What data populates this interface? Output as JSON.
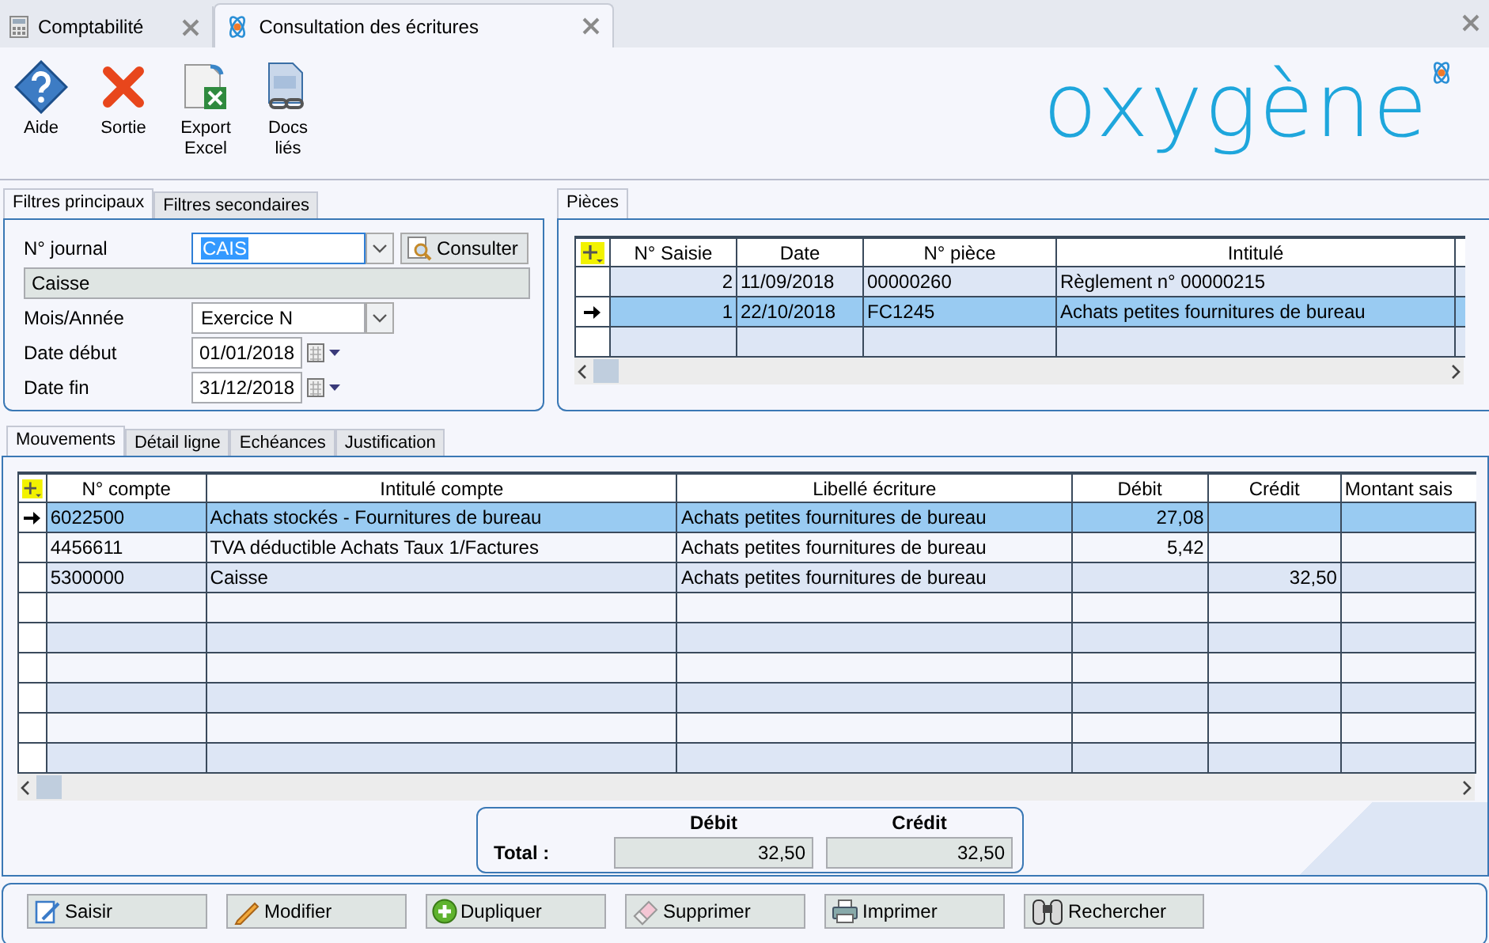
{
  "window_tabs": [
    {
      "label": "Comptabilité",
      "kind": "calculator",
      "selected": false
    },
    {
      "label": "Consultation des écritures",
      "kind": "atom",
      "selected": true
    }
  ],
  "toolbar": [
    {
      "label": "Aide",
      "kind": "help"
    },
    {
      "label": "Sortie",
      "kind": "exit"
    },
    {
      "label": "Export\nExcel",
      "kind": "excel"
    },
    {
      "label": "Docs\nliés",
      "kind": "docs"
    }
  ],
  "logo": "oxygène",
  "filter_tabs": [
    {
      "label": "Filtres principaux",
      "selected": true
    },
    {
      "label": "Filtres secondaires",
      "selected": false
    }
  ],
  "filters": {
    "journal": {
      "label": "N° journal",
      "value": "CAIS",
      "description": "Caisse",
      "button": "Consulter"
    },
    "period": {
      "label": "Mois/Année",
      "value": "Exercice N"
    },
    "date_start": {
      "label": "Date début",
      "value": "01/01/2018"
    },
    "date_end": {
      "label": "Date fin",
      "value": "31/12/2018"
    }
  },
  "pieces": {
    "tab": "Pièces",
    "columns": [
      "N° Saisie",
      "Date",
      "N° pièce",
      "Intitulé"
    ],
    "rows": [
      {
        "entry_no": "2",
        "date": "11/09/2018",
        "piece_no": "00000260",
        "title": "Règlement n° 00000215",
        "selected": false
      },
      {
        "entry_no": "1",
        "date": "22/10/2018",
        "piece_no": "FC1245",
        "title": "Achats petites fournitures de bureau",
        "selected": true
      }
    ]
  },
  "detail_tabs": [
    {
      "label": "Mouvements",
      "selected": true
    },
    {
      "label": "Détail ligne",
      "selected": false
    },
    {
      "label": "Echéances",
      "selected": false
    },
    {
      "label": "Justification",
      "selected": false
    }
  ],
  "entries": {
    "columns": [
      "N° compte",
      "Intitulé compte",
      "Libellé écriture",
      "Débit",
      "Crédit",
      "Montant sais"
    ],
    "rows": [
      {
        "account": "6022500",
        "account_title": "Achats stockés - Fournitures de bureau",
        "entry_label": "Achats petites fournitures de bureau",
        "debit": "27,08",
        "selected": true
      },
      {
        "account": "4456611",
        "account_title": "TVA déductible Achats Taux 1/Factures",
        "entry_label": "Achats petites fournitures de bureau",
        "debit": "5,42",
        "selected": false
      },
      {
        "account": "5300000",
        "account_title": "Caisse",
        "entry_label": "Achats petites fournitures de bureau",
        "credit": "32,50",
        "selected": false
      }
    ]
  },
  "totals": {
    "label": "Total :",
    "debit_header": "Débit",
    "credit_header": "Crédit",
    "debit": "32,50",
    "credit": "32,50"
  },
  "actions": [
    {
      "label": "Saisir",
      "kind": "enter"
    },
    {
      "label": "Modifier",
      "kind": "edit"
    },
    {
      "label": "Dupliquer",
      "kind": "duplicate"
    },
    {
      "label": "Supprimer",
      "kind": "delete"
    },
    {
      "label": "Imprimer",
      "kind": "print"
    },
    {
      "label": "Rechercher",
      "kind": "search"
    }
  ]
}
